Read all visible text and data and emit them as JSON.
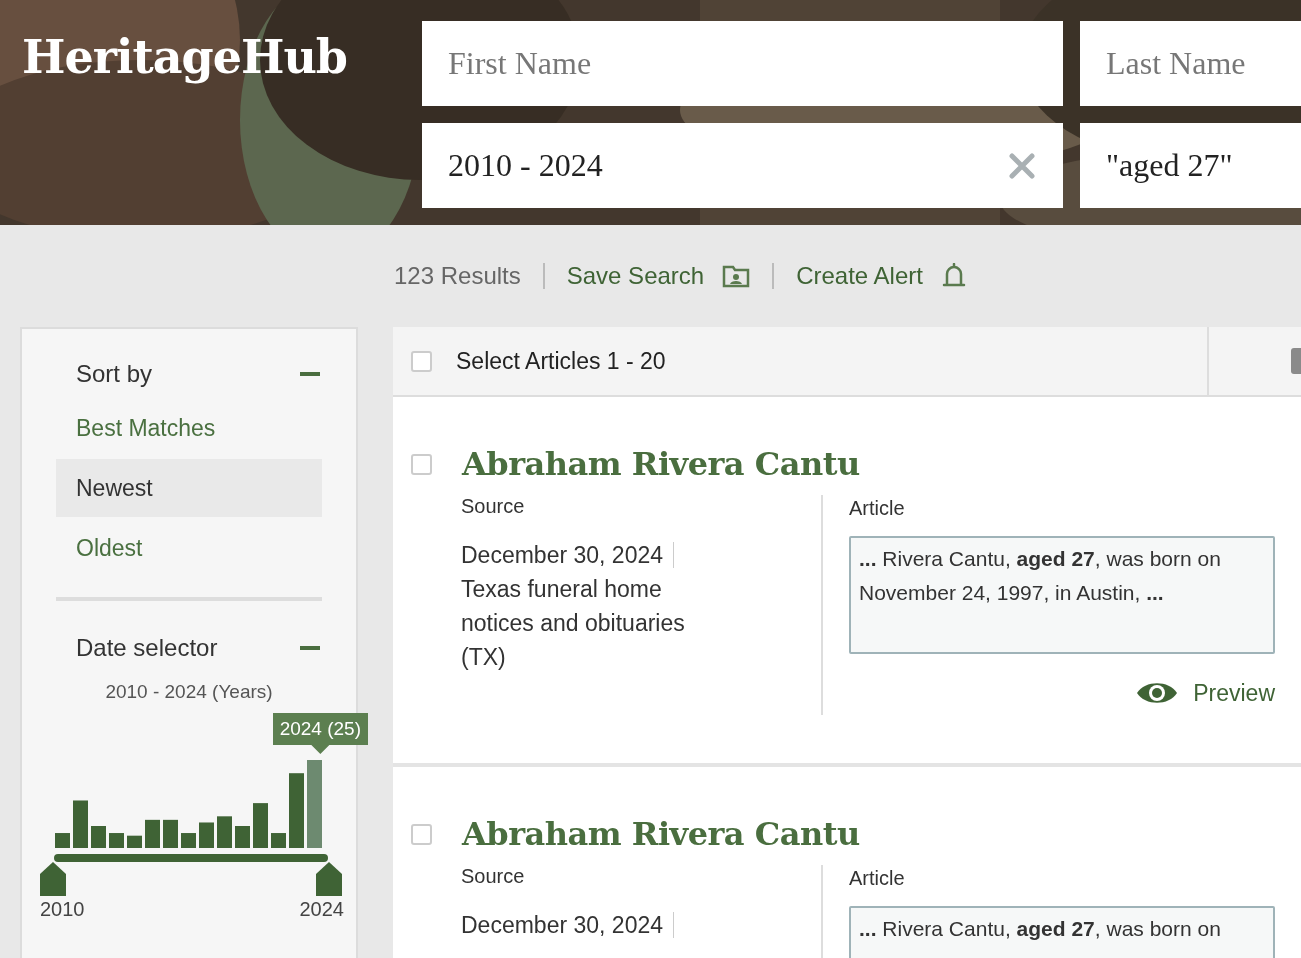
{
  "logo": "HeritageHub",
  "search": {
    "fields": [
      {
        "placeholder": "First Name",
        "clearable": false
      },
      {
        "placeholder": "Last Name",
        "clearable": false
      },
      {
        "value": "2010 - 2024",
        "clearable": true
      },
      {
        "value": "\"aged 27\"",
        "clearable": false
      }
    ]
  },
  "toolbar": {
    "results": "123 Results",
    "actions": [
      {
        "label": "Save Search"
      },
      {
        "label": "Create Alert"
      }
    ]
  },
  "sidebar": {
    "sort": {
      "title": "Sort by",
      "expanded": true,
      "options": [
        {
          "label": "Best Matches",
          "selected": false
        },
        {
          "label": "Newest",
          "selected": true
        },
        {
          "label": "Oldest",
          "selected": false
        }
      ]
    },
    "date": {
      "title": "Date selector",
      "expanded": true,
      "range": "2010 - 2024 (Years)",
      "start": "2010",
      "end": "2024",
      "tooltip": "2024 (25)",
      "bars": [
        {
          "selected": false
        },
        {
          "selected": false
        },
        {
          "selected": false
        },
        {
          "selected": false
        },
        {
          "selected": false
        },
        {
          "selected": false
        },
        {
          "selected": false
        },
        {
          "selected": false
        },
        {
          "selected": false
        },
        {
          "selected": false
        },
        {
          "selected": false
        },
        {
          "selected": false
        },
        {
          "selected": false
        },
        {
          "selected": false
        },
        {
          "selected": true
        }
      ]
    }
  },
  "results": {
    "select_label": "Select Articles 1 - 20",
    "select_checked": false,
    "items": [
      {
        "title": "Abraham Rivera Cantu",
        "checked": false,
        "source_label": "Source",
        "date": "December 30, 2024",
        "publication": "Texas funeral home notices and obituaries (TX)",
        "article_label": "Article",
        "snippet": "**...** Rivera Cantu, **aged 27**, was born on November 24, 1997, in Austin, **...**",
        "preview": "Preview"
      },
      {
        "title": "Abraham Rivera Cantu",
        "checked": false,
        "source_label": "Source",
        "date": "December 30, 2024",
        "article_label": "Article",
        "snippet": "**...** Rivera Cantu, **aged 27**, was born on"
      }
    ]
  }
}
